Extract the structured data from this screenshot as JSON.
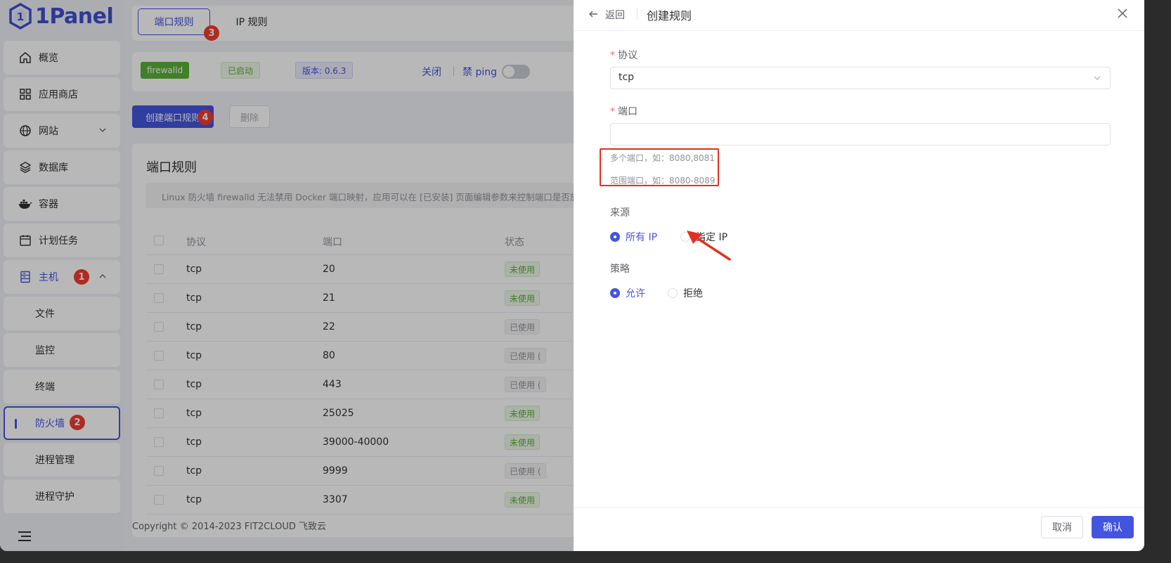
{
  "brand": {
    "name": "1Panel"
  },
  "sidebar": {
    "items": [
      {
        "label": "概览",
        "icon": "home-icon"
      },
      {
        "label": "应用商店",
        "icon": "grid-icon"
      },
      {
        "label": "网站",
        "icon": "globe-icon"
      },
      {
        "label": "数据库",
        "icon": "layers-icon"
      },
      {
        "label": "容器",
        "icon": "docker-icon"
      },
      {
        "label": "计划任务",
        "icon": "calendar-icon"
      },
      {
        "label": "主机",
        "icon": "server-icon"
      }
    ],
    "sub_items": [
      {
        "label": "文件"
      },
      {
        "label": "监控"
      },
      {
        "label": "终端"
      },
      {
        "label": "防火墙"
      },
      {
        "label": "进程管理"
      },
      {
        "label": "进程守护"
      }
    ]
  },
  "badges": {
    "b1": "1",
    "b2": "2",
    "b3": "3",
    "b4": "4"
  },
  "tabs": {
    "port": "端口规则",
    "ip": "IP 规则"
  },
  "status": {
    "engine": "firewalld",
    "state": "已启动",
    "version": "版本: 0.6.3",
    "stop": "关闭",
    "ping": "禁 ping"
  },
  "actions": {
    "create": "创建端口规则",
    "delete": "删除"
  },
  "table": {
    "title": "端口规则",
    "note": "Linux 防火墙 firewalld 无法禁用 Docker 端口映射，应用可以在 [已安装] 页面编辑参数来控制端口是否放开",
    "headers": {
      "protocol": "协议",
      "port": "端口",
      "status": "状态"
    },
    "rows": [
      {
        "protocol": "tcp",
        "port": "20",
        "status": "未使用",
        "kind": "unused"
      },
      {
        "protocol": "tcp",
        "port": "21",
        "status": "未使用",
        "kind": "unused"
      },
      {
        "protocol": "tcp",
        "port": "22",
        "status": "已使用",
        "kind": "used"
      },
      {
        "protocol": "tcp",
        "port": "80",
        "status": "已使用 (",
        "kind": "used"
      },
      {
        "protocol": "tcp",
        "port": "443",
        "status": "已使用 (",
        "kind": "used"
      },
      {
        "protocol": "tcp",
        "port": "25025",
        "status": "未使用",
        "kind": "unused"
      },
      {
        "protocol": "tcp",
        "port": "39000-40000",
        "status": "未使用",
        "kind": "unused"
      },
      {
        "protocol": "tcp",
        "port": "9999",
        "status": "已使用 (",
        "kind": "used"
      },
      {
        "protocol": "tcp",
        "port": "3307",
        "status": "未使用",
        "kind": "unused"
      }
    ]
  },
  "footer": {
    "copyright": "Copyright © 2014-2023 FIT2CLOUD 飞致云"
  },
  "drawer": {
    "back": "返回",
    "title": "创建规则",
    "protocol_label": "协议",
    "protocol_value": "tcp",
    "port_label": "端口",
    "port_value": "",
    "hint_multi": "多个端口，如：8080,8081",
    "hint_range": "范围端口，如：8080-8089",
    "source_label": "来源",
    "source_all": "所有 IP",
    "source_specific": "指定 IP",
    "policy_label": "策略",
    "policy_allow": "允许",
    "policy_deny": "拒绝",
    "cancel": "取消",
    "confirm": "确认"
  },
  "colors": {
    "primary": "#4355e0",
    "annotation_red": "#e3301f",
    "success": "#5bb03a"
  }
}
